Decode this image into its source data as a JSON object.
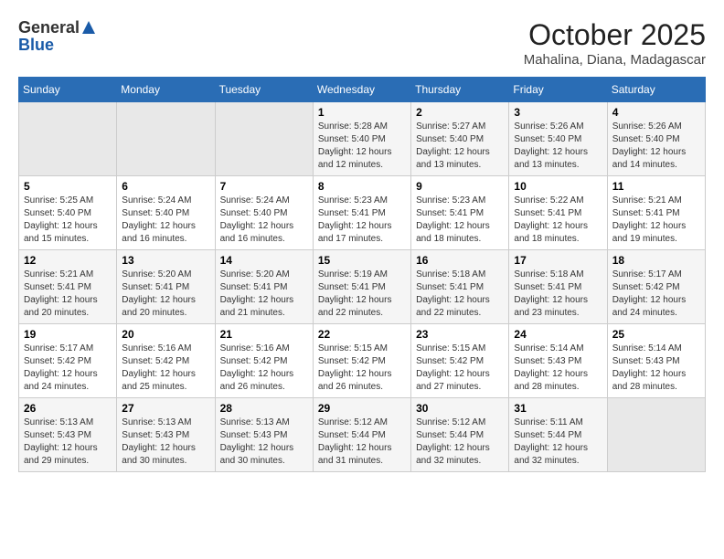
{
  "header": {
    "logo_general": "General",
    "logo_blue": "Blue",
    "month_year": "October 2025",
    "location": "Mahalina, Diana, Madagascar"
  },
  "weekdays": [
    "Sunday",
    "Monday",
    "Tuesday",
    "Wednesday",
    "Thursday",
    "Friday",
    "Saturday"
  ],
  "weeks": [
    [
      {
        "day": "",
        "info": ""
      },
      {
        "day": "",
        "info": ""
      },
      {
        "day": "",
        "info": ""
      },
      {
        "day": "1",
        "info": "Sunrise: 5:28 AM\nSunset: 5:40 PM\nDaylight: 12 hours\nand 12 minutes."
      },
      {
        "day": "2",
        "info": "Sunrise: 5:27 AM\nSunset: 5:40 PM\nDaylight: 12 hours\nand 13 minutes."
      },
      {
        "day": "3",
        "info": "Sunrise: 5:26 AM\nSunset: 5:40 PM\nDaylight: 12 hours\nand 13 minutes."
      },
      {
        "day": "4",
        "info": "Sunrise: 5:26 AM\nSunset: 5:40 PM\nDaylight: 12 hours\nand 14 minutes."
      }
    ],
    [
      {
        "day": "5",
        "info": "Sunrise: 5:25 AM\nSunset: 5:40 PM\nDaylight: 12 hours\nand 15 minutes."
      },
      {
        "day": "6",
        "info": "Sunrise: 5:24 AM\nSunset: 5:40 PM\nDaylight: 12 hours\nand 16 minutes."
      },
      {
        "day": "7",
        "info": "Sunrise: 5:24 AM\nSunset: 5:40 PM\nDaylight: 12 hours\nand 16 minutes."
      },
      {
        "day": "8",
        "info": "Sunrise: 5:23 AM\nSunset: 5:41 PM\nDaylight: 12 hours\nand 17 minutes."
      },
      {
        "day": "9",
        "info": "Sunrise: 5:23 AM\nSunset: 5:41 PM\nDaylight: 12 hours\nand 18 minutes."
      },
      {
        "day": "10",
        "info": "Sunrise: 5:22 AM\nSunset: 5:41 PM\nDaylight: 12 hours\nand 18 minutes."
      },
      {
        "day": "11",
        "info": "Sunrise: 5:21 AM\nSunset: 5:41 PM\nDaylight: 12 hours\nand 19 minutes."
      }
    ],
    [
      {
        "day": "12",
        "info": "Sunrise: 5:21 AM\nSunset: 5:41 PM\nDaylight: 12 hours\nand 20 minutes."
      },
      {
        "day": "13",
        "info": "Sunrise: 5:20 AM\nSunset: 5:41 PM\nDaylight: 12 hours\nand 20 minutes."
      },
      {
        "day": "14",
        "info": "Sunrise: 5:20 AM\nSunset: 5:41 PM\nDaylight: 12 hours\nand 21 minutes."
      },
      {
        "day": "15",
        "info": "Sunrise: 5:19 AM\nSunset: 5:41 PM\nDaylight: 12 hours\nand 22 minutes."
      },
      {
        "day": "16",
        "info": "Sunrise: 5:18 AM\nSunset: 5:41 PM\nDaylight: 12 hours\nand 22 minutes."
      },
      {
        "day": "17",
        "info": "Sunrise: 5:18 AM\nSunset: 5:41 PM\nDaylight: 12 hours\nand 23 minutes."
      },
      {
        "day": "18",
        "info": "Sunrise: 5:17 AM\nSunset: 5:42 PM\nDaylight: 12 hours\nand 24 minutes."
      }
    ],
    [
      {
        "day": "19",
        "info": "Sunrise: 5:17 AM\nSunset: 5:42 PM\nDaylight: 12 hours\nand 24 minutes."
      },
      {
        "day": "20",
        "info": "Sunrise: 5:16 AM\nSunset: 5:42 PM\nDaylight: 12 hours\nand 25 minutes."
      },
      {
        "day": "21",
        "info": "Sunrise: 5:16 AM\nSunset: 5:42 PM\nDaylight: 12 hours\nand 26 minutes."
      },
      {
        "day": "22",
        "info": "Sunrise: 5:15 AM\nSunset: 5:42 PM\nDaylight: 12 hours\nand 26 minutes."
      },
      {
        "day": "23",
        "info": "Sunrise: 5:15 AM\nSunset: 5:42 PM\nDaylight: 12 hours\nand 27 minutes."
      },
      {
        "day": "24",
        "info": "Sunrise: 5:14 AM\nSunset: 5:43 PM\nDaylight: 12 hours\nand 28 minutes."
      },
      {
        "day": "25",
        "info": "Sunrise: 5:14 AM\nSunset: 5:43 PM\nDaylight: 12 hours\nand 28 minutes."
      }
    ],
    [
      {
        "day": "26",
        "info": "Sunrise: 5:13 AM\nSunset: 5:43 PM\nDaylight: 12 hours\nand 29 minutes."
      },
      {
        "day": "27",
        "info": "Sunrise: 5:13 AM\nSunset: 5:43 PM\nDaylight: 12 hours\nand 30 minutes."
      },
      {
        "day": "28",
        "info": "Sunrise: 5:13 AM\nSunset: 5:43 PM\nDaylight: 12 hours\nand 30 minutes."
      },
      {
        "day": "29",
        "info": "Sunrise: 5:12 AM\nSunset: 5:44 PM\nDaylight: 12 hours\nand 31 minutes."
      },
      {
        "day": "30",
        "info": "Sunrise: 5:12 AM\nSunset: 5:44 PM\nDaylight: 12 hours\nand 32 minutes."
      },
      {
        "day": "31",
        "info": "Sunrise: 5:11 AM\nSunset: 5:44 PM\nDaylight: 12 hours\nand 32 minutes."
      },
      {
        "day": "",
        "info": ""
      }
    ]
  ]
}
